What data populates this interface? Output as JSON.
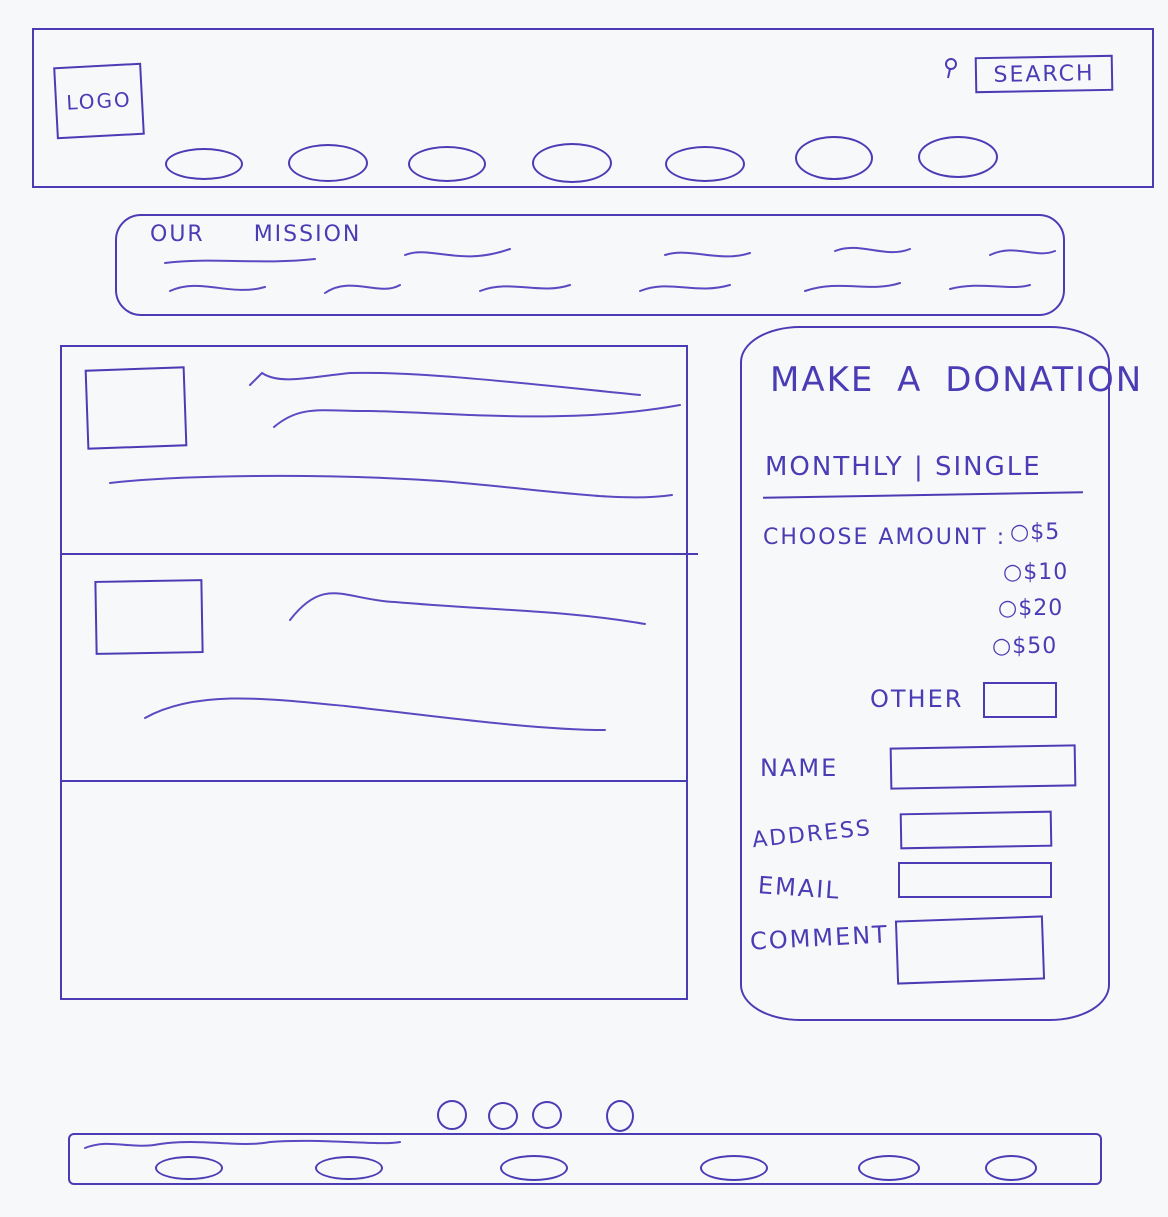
{
  "header": {
    "logo_label": "LOGO",
    "search_label": "SEARCH",
    "search_icon": "magnifier-icon",
    "nav_count": 7
  },
  "mission": {
    "title": "OUR MISSION"
  },
  "donation": {
    "title": "MAKE A DONATION",
    "frequency_label": "MONTHLY | SINGLE",
    "choose_amount_label": "CHOOSE AMOUNT :",
    "amounts": [
      "$5",
      "$10",
      "$20",
      "$50"
    ],
    "other_label": "OTHER",
    "name_label": "NAME",
    "address_label": "ADDRESS",
    "email_label": "EMAIL",
    "comment_label": "COMMENT"
  },
  "pager": {
    "dots": 4
  },
  "footer": {
    "link_count": 6
  },
  "colors": {
    "ink": "#4b3cb5",
    "paper": "#f7f8fa"
  }
}
